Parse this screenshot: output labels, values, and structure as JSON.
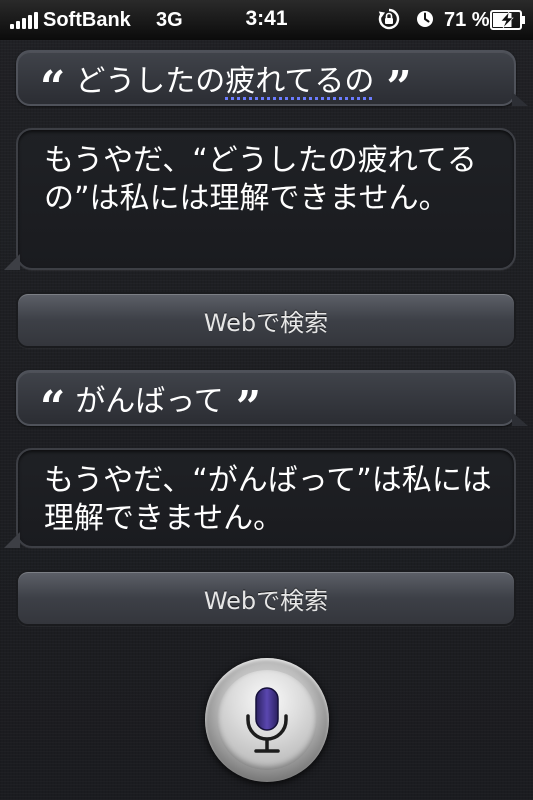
{
  "status_bar": {
    "carrier": "SoftBank",
    "network": "3G",
    "time": "3:41",
    "battery_percent": "71 %",
    "battery_level": 0.71
  },
  "conversation": [
    {
      "user_query_parts": [
        "どうしたの",
        "疲",
        "れてるの"
      ],
      "siri_response": "もうやだ、“どうしたの疲れてるの”は私には理解できません。",
      "search_button": "Webで検索"
    },
    {
      "user_query_parts": [
        "がんばって"
      ],
      "siri_response": "もうやだ、“がんばって”は私には理解できません。",
      "search_button": "Webで検索"
    }
  ],
  "quote_open": "“",
  "quote_close": "”",
  "colors": {
    "mic_accent": "#4a3a8c",
    "dictation_underline": "#6c7cff"
  }
}
